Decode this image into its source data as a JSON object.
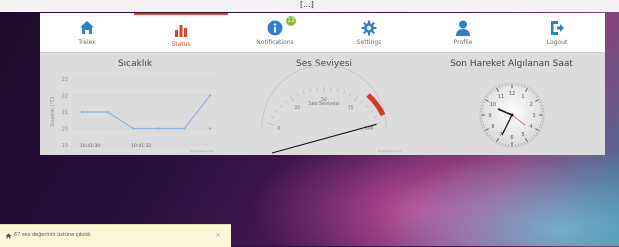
{
  "page_mark": "[...]",
  "nav": {
    "items": [
      {
        "label": "Trelex",
        "icon": "home-icon",
        "active": false
      },
      {
        "label": "Status",
        "icon": "bar-chart-icon",
        "active": true
      },
      {
        "label": "Notifications",
        "icon": "info-icon",
        "active": false,
        "badge": "12"
      },
      {
        "label": "Settings",
        "icon": "gear-icon",
        "active": false
      },
      {
        "label": "Profile",
        "icon": "user-icon",
        "active": false
      },
      {
        "label": "Logout",
        "icon": "logout-icon",
        "active": false
      }
    ]
  },
  "temperature": {
    "title": "Sıcaklık",
    "ylabel": "Sıcaklık (°C)",
    "yticks": [
      "23",
      "22",
      "21",
      "20",
      "19"
    ],
    "xticks": [
      "10:41:30",
      "10:41:32"
    ],
    "credit": "Highcharts.com",
    "chart_data": {
      "type": "line",
      "ylim": [
        19,
        23
      ],
      "points": [
        21,
        21,
        20,
        20,
        20,
        22
      ]
    },
    "outlier": 20
  },
  "sound": {
    "title": "Ses Seviyesi",
    "gauge_label": "Ses Seviyesi",
    "scale_labels": [
      "0",
      "25",
      "50",
      "75",
      "100"
    ],
    "credit": "Highcharts.com",
    "gauge_max": 100,
    "needle_value": 100
  },
  "motion": {
    "title": "Son Hareket Algılanan Saat",
    "clock_numbers": [
      "12",
      "1",
      "2",
      "3",
      "4",
      "5",
      "6",
      "7",
      "8",
      "9",
      "10",
      "11"
    ]
  },
  "toast": {
    "text": "67 ses değerinin üstüne çıkıldı",
    "close": "×"
  },
  "colors": {
    "accent": "#e2422b",
    "nav_icon": "#2f7fd0",
    "line": "#8fb3df",
    "badge": "#8cb83a"
  }
}
